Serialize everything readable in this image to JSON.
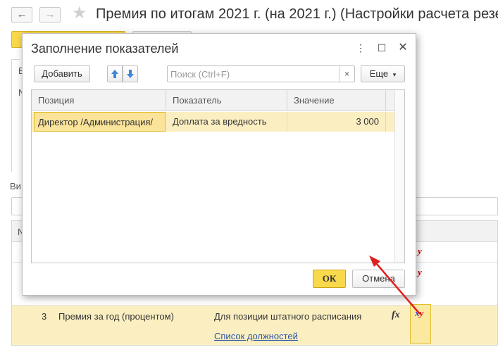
{
  "background_window": {
    "back_icon": "arrow-left-icon",
    "forward_icon": "arrow-right-icon",
    "star_icon": "star-icon",
    "title": "Премия по итогам 2021 г. (на 2021 г.) (Настройки расчета резе…",
    "side_letters": [
      "В",
      "N"
    ],
    "label_vi": "Ви",
    "table_header_n": "N",
    "row": {
      "number": "3",
      "name": "Премия за год (процентом)",
      "description": "Для позиции штатного расписания",
      "link": "Список должностей"
    },
    "fx_icon": "fx",
    "xy_icon": {
      "x": "x",
      "y": "y"
    }
  },
  "dialog": {
    "title": "Заполнение показателей",
    "more_icon": "⋮",
    "maximize_icon": "☐",
    "close_icon": "✕",
    "toolbar": {
      "add_label": "Добавить",
      "up_icon": "arrow-up-icon",
      "down_icon": "arrow-down-icon",
      "search_placeholder": "Поиск (Ctrl+F)",
      "clear_icon": "×",
      "more_label": "Еще",
      "more_arrow": "▾"
    },
    "table": {
      "columns": [
        "Позиция",
        "Показатель",
        "Значение"
      ],
      "rows": [
        {
          "position": "Директор /Администрация/",
          "indicator": "Доплата за вредность",
          "value": "3 000"
        }
      ]
    },
    "ok_label": "ОК",
    "cancel_label": "Отмена"
  },
  "colors": {
    "accent_yellow": "#f9d94c",
    "selection_row": "#fbefc2",
    "link_blue": "#2a55a6",
    "annotation_red": "#e02020"
  }
}
